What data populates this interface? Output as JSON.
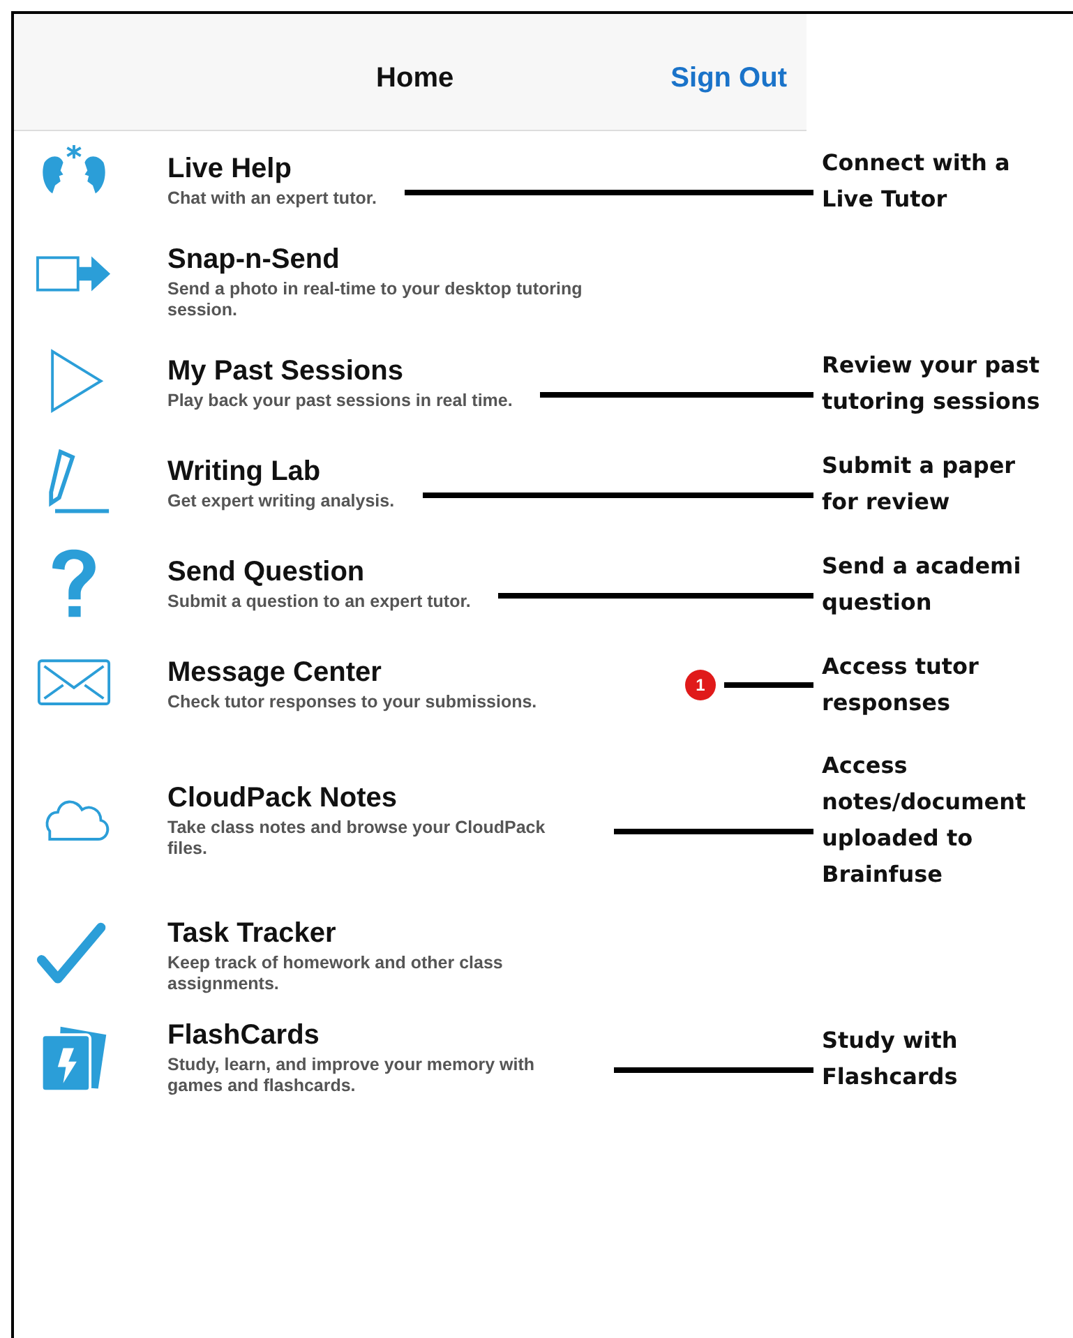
{
  "header": {
    "title": "Home",
    "action": "Sign Out"
  },
  "items": [
    {
      "title": "Live Help",
      "description": "Chat with an expert tutor.",
      "callout": [
        "Connect with a",
        "Live Tutor"
      ]
    },
    {
      "title": "Snap-n-Send",
      "description": "Send a photo in real-time to your desktop tutoring session."
    },
    {
      "title": "My Past Sessions",
      "description": "Play back your past sessions in real time.",
      "callout": [
        "Review your past",
        "tutoring sessions"
      ]
    },
    {
      "title": "Writing Lab",
      "description": "Get expert writing analysis.",
      "callout": [
        "Submit a paper",
        "for review"
      ]
    },
    {
      "title": "Send Question",
      "description": "Submit a question to an expert tutor.",
      "callout": [
        "Send a academi",
        "question"
      ]
    },
    {
      "title": "Message Center",
      "description": "Check tutor responses to your submissions.",
      "badge": "1",
      "callout": [
        "Access tutor",
        "responses"
      ]
    },
    {
      "title": "CloudPack Notes",
      "description": "Take class notes and browse your CloudPack files.",
      "callout": [
        "Access",
        "notes/document",
        "uploaded to",
        "Brainfuse"
      ]
    },
    {
      "title": "Task Tracker",
      "description": "Keep track of homework and other class assignments."
    },
    {
      "title": "FlashCards",
      "description": "Study, learn, and improve your memory with games and flashcards.",
      "callout": [
        "Study with",
        "Flashcards"
      ]
    }
  ]
}
